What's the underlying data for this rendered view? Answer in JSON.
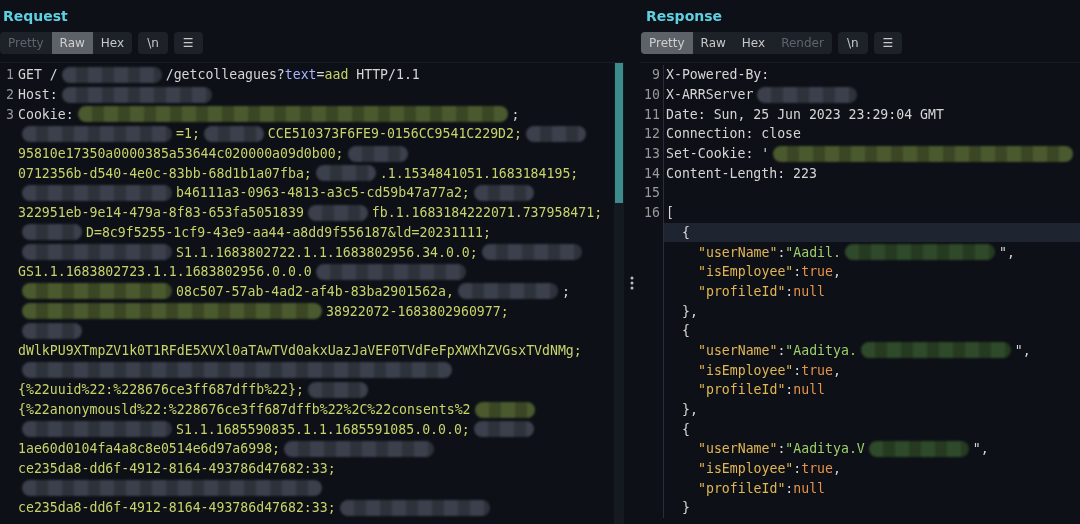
{
  "request": {
    "title": "Request",
    "tabs": [
      {
        "label": "Pretty",
        "selected": false,
        "disabled": true
      },
      {
        "label": "Raw",
        "selected": true,
        "disabled": false
      },
      {
        "label": "Hex",
        "selected": false,
        "disabled": false
      }
    ],
    "buttons": [
      "\\n",
      "☰"
    ],
    "lines": [
      {
        "number": "1",
        "segments": [
          {
            "kind": "text",
            "text": "GET /"
          },
          {
            "kind": "blur",
            "color": "#3b404c"
          },
          {
            "kind": "text",
            "text": "/getcolleagues?"
          },
          {
            "kind": "text",
            "color": "#aab4ff",
            "text": "text"
          },
          {
            "kind": "text",
            "text": "="
          },
          {
            "kind": "text",
            "color": "#c8d46a",
            "text": "aad"
          },
          {
            "kind": "text",
            "text": " HTTP/1.1"
          }
        ]
      },
      {
        "number": "2",
        "segments": [
          {
            "kind": "text",
            "text": "Host:"
          },
          {
            "kind": "wideblur",
            "color": "#3b404c"
          }
        ]
      },
      {
        "number": "3",
        "segments": [
          {
            "kind": "text",
            "text": "Cookie:"
          },
          {
            "kind": "fullblur",
            "color": "#4b5a2e"
          },
          {
            "kind": "text",
            "text": ";"
          }
        ]
      },
      {
        "segments": [
          {
            "kind": "wideblur",
            "color": "#3b404c"
          },
          {
            "kind": "text",
            "color": "#c8d46a",
            "text": "=1;"
          },
          {
            "kind": "shortblur",
            "color": "#3b404c"
          },
          {
            "kind": "text",
            "color": "#c8d46a",
            "text": "CCE510373F6FE9-0156CC9541C229D2;"
          },
          {
            "kind": "shortblur",
            "color": "#3b404c"
          }
        ]
      },
      {
        "segments": [
          {
            "kind": "text",
            "color": "#c8d46a",
            "text": "95810e17350a0000385a53644c020000a09d0b00;"
          },
          {
            "kind": "shortblur",
            "color": "#3b404c"
          }
        ]
      },
      {
        "segments": [
          {
            "kind": "text",
            "color": "#c8d46a",
            "text": "0712356b-d540-4e0c-83bb-68d1b1a07fba;"
          },
          {
            "kind": "shortblur",
            "color": "#3b404c"
          },
          {
            "kind": "text",
            "color": "#c8d46a",
            "text": ".1.1534841051.1683184195;"
          }
        ]
      },
      {
        "segments": [
          {
            "kind": "wideblur",
            "color": "#3b404c"
          },
          {
            "kind": "text",
            "color": "#c8d46a",
            "text": "b46111a3-0963-4813-a3c5-cd59b47a77a2;"
          },
          {
            "kind": "shortblur",
            "color": "#3b404c"
          }
        ]
      },
      {
        "segments": [
          {
            "kind": "text",
            "color": "#c8d46a",
            "text": "322951eb-9e14-479a-8f83-653fa5051839"
          },
          {
            "kind": "shortblur",
            "color": "#3b404c"
          },
          {
            "kind": "text",
            "color": "#c8d46a",
            "text": "fb.1.1683184222071.737958471;"
          }
        ]
      },
      {
        "segments": [
          {
            "kind": "shortblur",
            "color": "#3b404c"
          },
          {
            "kind": "text",
            "color": "#c8d46a",
            "text": "D=8c9f5255-1cf9-43e9-aa44-a8dd9f556187&ld=20231111;"
          }
        ]
      },
      {
        "segments": [
          {
            "kind": "wideblur",
            "color": "#3b404c"
          },
          {
            "kind": "text",
            "color": "#c8d46a",
            "text": "S1.1.1683802722.1.1.1683802956.34.0.0;"
          },
          {
            "kind": "blur",
            "color": "#3b404c"
          }
        ]
      },
      {
        "segments": [
          {
            "kind": "text",
            "color": "#c8d46a",
            "text": "GS1.1.1683802723.1.1.1683802956.0.0.0"
          },
          {
            "kind": "wideblur",
            "color": "#3b404c"
          }
        ]
      },
      {
        "segments": [
          {
            "kind": "wideblur",
            "color": "#4b5a2e"
          },
          {
            "kind": "text",
            "color": "#c8d46a",
            "text": "08c507-57ab-4ad2-af4b-83ba2901562a,"
          },
          {
            "kind": "blur",
            "color": "#3b404c"
          },
          {
            "kind": "text",
            "text": ";"
          }
        ]
      },
      {
        "segments": [
          {
            "kind": "longblur",
            "color": "#4b5a2e"
          },
          {
            "kind": "text",
            "color": "#c8d46a",
            "text": "38922072-1683802960977;"
          }
        ]
      },
      {
        "segments": [
          {
            "kind": "shortblur",
            "color": "#3b404c"
          }
        ]
      },
      {
        "segments": [
          {
            "kind": "text",
            "color": "#c8d46a",
            "text": "dWlkPU9XTmpZV1k0T1RFdE5XVXl0aTAwTVd0akxUazJaVEF0TVdFeFpXWXhZVGsxTVdNMg;"
          }
        ]
      },
      {
        "segments": [
          {
            "kind": "fullblur",
            "color": "#3b404c"
          }
        ]
      },
      {
        "segments": [
          {
            "kind": "text",
            "color": "#c8d46a",
            "text": "{%22uuid%22:%228676ce3ff687dffb%22};"
          },
          {
            "kind": "shortblur",
            "color": "#3b404c"
          }
        ]
      },
      {
        "segments": [
          {
            "kind": "text",
            "color": "#c8d46a",
            "text": "{%22anonymousld%22:%228676ce3ff687dffb%22%2C%22consents%2"
          },
          {
            "kind": "shortblur",
            "color": "#4b5a2e"
          }
        ]
      },
      {
        "segments": [
          {
            "kind": "wideblur",
            "color": "#3b404c"
          },
          {
            "kind": "text",
            "color": "#c8d46a",
            "text": "S1.1.1685590835.1.1.1685591085.0.0.0;"
          },
          {
            "kind": "shortblur",
            "color": "#3b404c"
          }
        ]
      },
      {
        "segments": [
          {
            "kind": "text",
            "color": "#c8d46a",
            "text": "1ae60d0104fa4a8c8e0514e6d97a6998;"
          },
          {
            "kind": "wideblur",
            "color": "#3b404c"
          }
        ]
      },
      {
        "segments": [
          {
            "kind": "text",
            "color": "#c8d46a",
            "text": "ce235da8-dd6f-4912-8164-493786d47682:33;"
          }
        ]
      },
      {
        "segments": [
          {
            "kind": "longblur",
            "color": "#3b404c"
          }
        ]
      },
      {
        "segments": [
          {
            "kind": "text",
            "color": "#c8d46a",
            "text": "ce235da8-dd6f-4912-8164-493786d47682:33;"
          },
          {
            "kind": "wideblur",
            "color": "#3b404c"
          }
        ]
      }
    ]
  },
  "response": {
    "title": "Response",
    "tabs": [
      {
        "label": "Pretty",
        "selected": true,
        "disabled": false
      },
      {
        "label": "Raw",
        "selected": false,
        "disabled": false
      },
      {
        "label": "Hex",
        "selected": false,
        "disabled": false
      },
      {
        "label": "Render",
        "selected": false,
        "disabled": true
      }
    ],
    "buttons": [
      "\\n",
      "☰"
    ],
    "lines": [
      {
        "number": "9",
        "kind": "header",
        "current": false,
        "segments": [
          {
            "kind": "text",
            "text": "X-Powered-By:"
          }
        ]
      },
      {
        "number": "10",
        "kind": "header",
        "current": false,
        "segments": [
          {
            "kind": "text",
            "text": "X-ARRServer"
          },
          {
            "kind": "blur",
            "color": "#3b404c"
          }
        ]
      },
      {
        "number": "11",
        "kind": "header",
        "current": false,
        "segments": [
          {
            "kind": "text",
            "text": "Date: Sun, 25 Jun 2023 23:29:04 GMT"
          }
        ]
      },
      {
        "number": "12",
        "kind": "header",
        "current": false,
        "segments": [
          {
            "kind": "text",
            "text": "Connection: close"
          }
        ]
      },
      {
        "number": "13",
        "kind": "header",
        "current": false,
        "segments": [
          {
            "kind": "text",
            "text": "Set-Cookie: '"
          },
          {
            "kind": "longblur",
            "color": "#4b5a2e"
          }
        ]
      },
      {
        "number": "14",
        "kind": "header",
        "current": false,
        "segments": [
          {
            "kind": "text",
            "text": "Content-Length: 223"
          }
        ]
      },
      {
        "number": "15",
        "kind": "header",
        "current": false
      },
      {
        "number": "16",
        "kind": "header",
        "current": false,
        "segments": [
          {
            "kind": "text",
            "text": "["
          }
        ]
      },
      {
        "kind": "object",
        "current": true,
        "segments": [
          {
            "kind": "text",
            "text": "{"
          }
        ]
      },
      {
        "kind": "member",
        "current": false,
        "segments": [
          {
            "kind": "text",
            "color": "#e2b657",
            "text": "\"userName\""
          },
          {
            "kind": "text",
            "text": ":"
          },
          {
            "kind": "text",
            "color": "#9fcf6a",
            "text": "\"Aadil."
          },
          {
            "kind": "wideblur",
            "color": "#2f4a2a"
          },
          {
            "kind": "text",
            "text": "\","
          }
        ]
      },
      {
        "kind": "member",
        "current": false,
        "segments": [
          {
            "kind": "text",
            "color": "#e2b657",
            "text": "\"isEmployee\""
          },
          {
            "kind": "text",
            "text": ":"
          },
          {
            "kind": "text",
            "color": "#e8924a",
            "text": "true"
          },
          {
            "kind": "text",
            "text": ","
          }
        ]
      },
      {
        "kind": "member",
        "current": false,
        "segments": [
          {
            "kind": "text",
            "color": "#e2b657",
            "text": "\"profileId\""
          },
          {
            "kind": "text",
            "text": ":"
          },
          {
            "kind": "text",
            "color": "#e8924a",
            "text": "null"
          }
        ]
      },
      {
        "kind": "object",
        "current": false,
        "segments": [
          {
            "kind": "text",
            "text": "},"
          }
        ]
      },
      {
        "kind": "object",
        "current": false,
        "segments": [
          {
            "kind": "text",
            "text": "{"
          }
        ]
      },
      {
        "kind": "member",
        "current": false,
        "segments": [
          {
            "kind": "text",
            "color": "#e2b657",
            "text": "\"userName\""
          },
          {
            "kind": "text",
            "text": ":"
          },
          {
            "kind": "text",
            "color": "#9fcf6a",
            "text": "\"Aaditya."
          },
          {
            "kind": "wideblur",
            "color": "#2f4a2a"
          },
          {
            "kind": "text",
            "text": "\","
          }
        ]
      },
      {
        "kind": "member",
        "current": false,
        "segments": [
          {
            "kind": "text",
            "color": "#e2b657",
            "text": "\"isEmployee\""
          },
          {
            "kind": "text",
            "text": ":"
          },
          {
            "kind": "text",
            "color": "#e8924a",
            "text": "true"
          },
          {
            "kind": "text",
            "text": ","
          }
        ]
      },
      {
        "kind": "member",
        "current": false,
        "segments": [
          {
            "kind": "text",
            "color": "#e2b657",
            "text": "\"profileId\""
          },
          {
            "kind": "text",
            "text": ":"
          },
          {
            "kind": "text",
            "color": "#e8924a",
            "text": "null"
          }
        ]
      },
      {
        "kind": "object",
        "current": false,
        "segments": [
          {
            "kind": "text",
            "text": "},"
          }
        ]
      },
      {
        "kind": "object",
        "current": false,
        "segments": [
          {
            "kind": "text",
            "text": "{"
          }
        ]
      },
      {
        "kind": "member",
        "current": false,
        "segments": [
          {
            "kind": "text",
            "color": "#e2b657",
            "text": "\"userName\""
          },
          {
            "kind": "text",
            "text": ":"
          },
          {
            "kind": "text",
            "color": "#9fcf6a",
            "text": "\"Aaditya.V"
          },
          {
            "kind": "blur",
            "color": "#2f4a2a"
          },
          {
            "kind": "text",
            "text": "\","
          }
        ]
      },
      {
        "kind": "member",
        "current": false,
        "segments": [
          {
            "kind": "text",
            "color": "#e2b657",
            "text": "\"isEmployee\""
          },
          {
            "kind": "text",
            "text": ":"
          },
          {
            "kind": "text",
            "color": "#e8924a",
            "text": "true"
          },
          {
            "kind": "text",
            "text": ","
          }
        ]
      },
      {
        "kind": "member",
        "current": false,
        "segments": [
          {
            "kind": "text",
            "color": "#e2b657",
            "text": "\"profileId\""
          },
          {
            "kind": "text",
            "text": ":"
          },
          {
            "kind": "text",
            "color": "#e8924a",
            "text": "null"
          }
        ]
      },
      {
        "kind": "object",
        "current": false,
        "segments": [
          {
            "kind": "text",
            "text": "}"
          }
        ]
      }
    ]
  }
}
